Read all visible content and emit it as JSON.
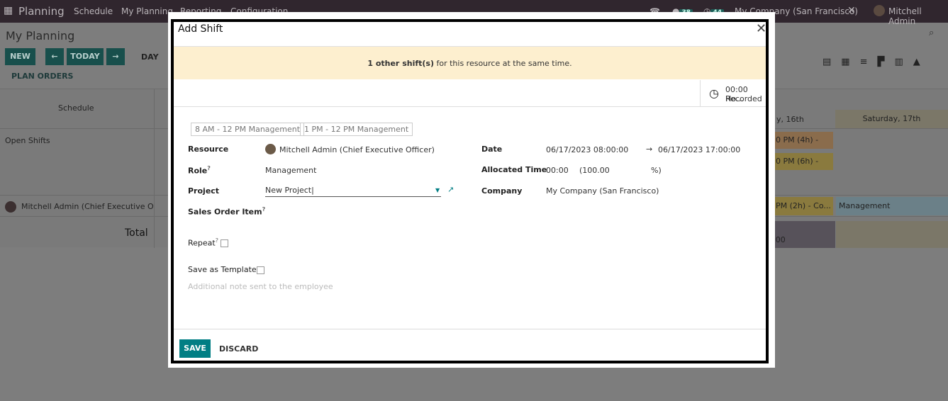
{
  "navbar": {
    "app": "Planning",
    "menu": [
      "Schedule",
      "My Planning",
      "Reporting",
      "Configuration"
    ],
    "messages_count": "38",
    "activities_count": "44",
    "company": "My Company (San Francisco)",
    "user": "Mitchell Admin"
  },
  "page": {
    "title": "My Planning",
    "new": "NEW",
    "today": "TODAY",
    "day": "DAY",
    "plan_orders": "PLAN ORDERS"
  },
  "schedule": {
    "header": "Schedule",
    "day_16": "y, 16th",
    "day_17": "Saturday, 17th",
    "rows": [
      "Open Shifts",
      "Mitchell Admin (Chief Executive Office",
      "Total"
    ],
    "shifts": [
      "0 PM (4h) - D...",
      "0 PM (6h) - C...",
      "PM (2h) - Co...",
      "Management",
      ":00"
    ]
  },
  "dialog": {
    "title": "Add Shift",
    "warning_bold": "1 other shift(s)",
    "warning_rest": " for this resource at the same time.",
    "hours": "00:00 Ho...",
    "hours_sub": "Recorded",
    "templates": [
      "8 AM - 12 PM Management",
      "1 PM - 12 PM Management"
    ],
    "resource_label": "Resource",
    "resource": "Mitchell Admin (Chief Executive Officer)",
    "role_label": "Role",
    "role": "Management",
    "project_label": "Project",
    "project": "New Project",
    "sale_label": "Sales Order Item",
    "repeat_label": "Repeat",
    "template_label": "Save as Template",
    "note_placeholder": "Additional note sent to the employee",
    "date_label": "Date",
    "date_start": "06/17/2023 08:00:00",
    "date_end": "06/17/2023 17:00:00",
    "alloc_label": "Allocated Time",
    "alloc": "00:00",
    "alloc_pct": "(100.00",
    "pct": "%)",
    "company_label": "Company",
    "company": "My Company (San Francisco)",
    "save": "SAVE",
    "discard": "DISCARD"
  },
  "colors": {
    "accent": "#017e84",
    "warning_bg": "#fdefcf"
  }
}
